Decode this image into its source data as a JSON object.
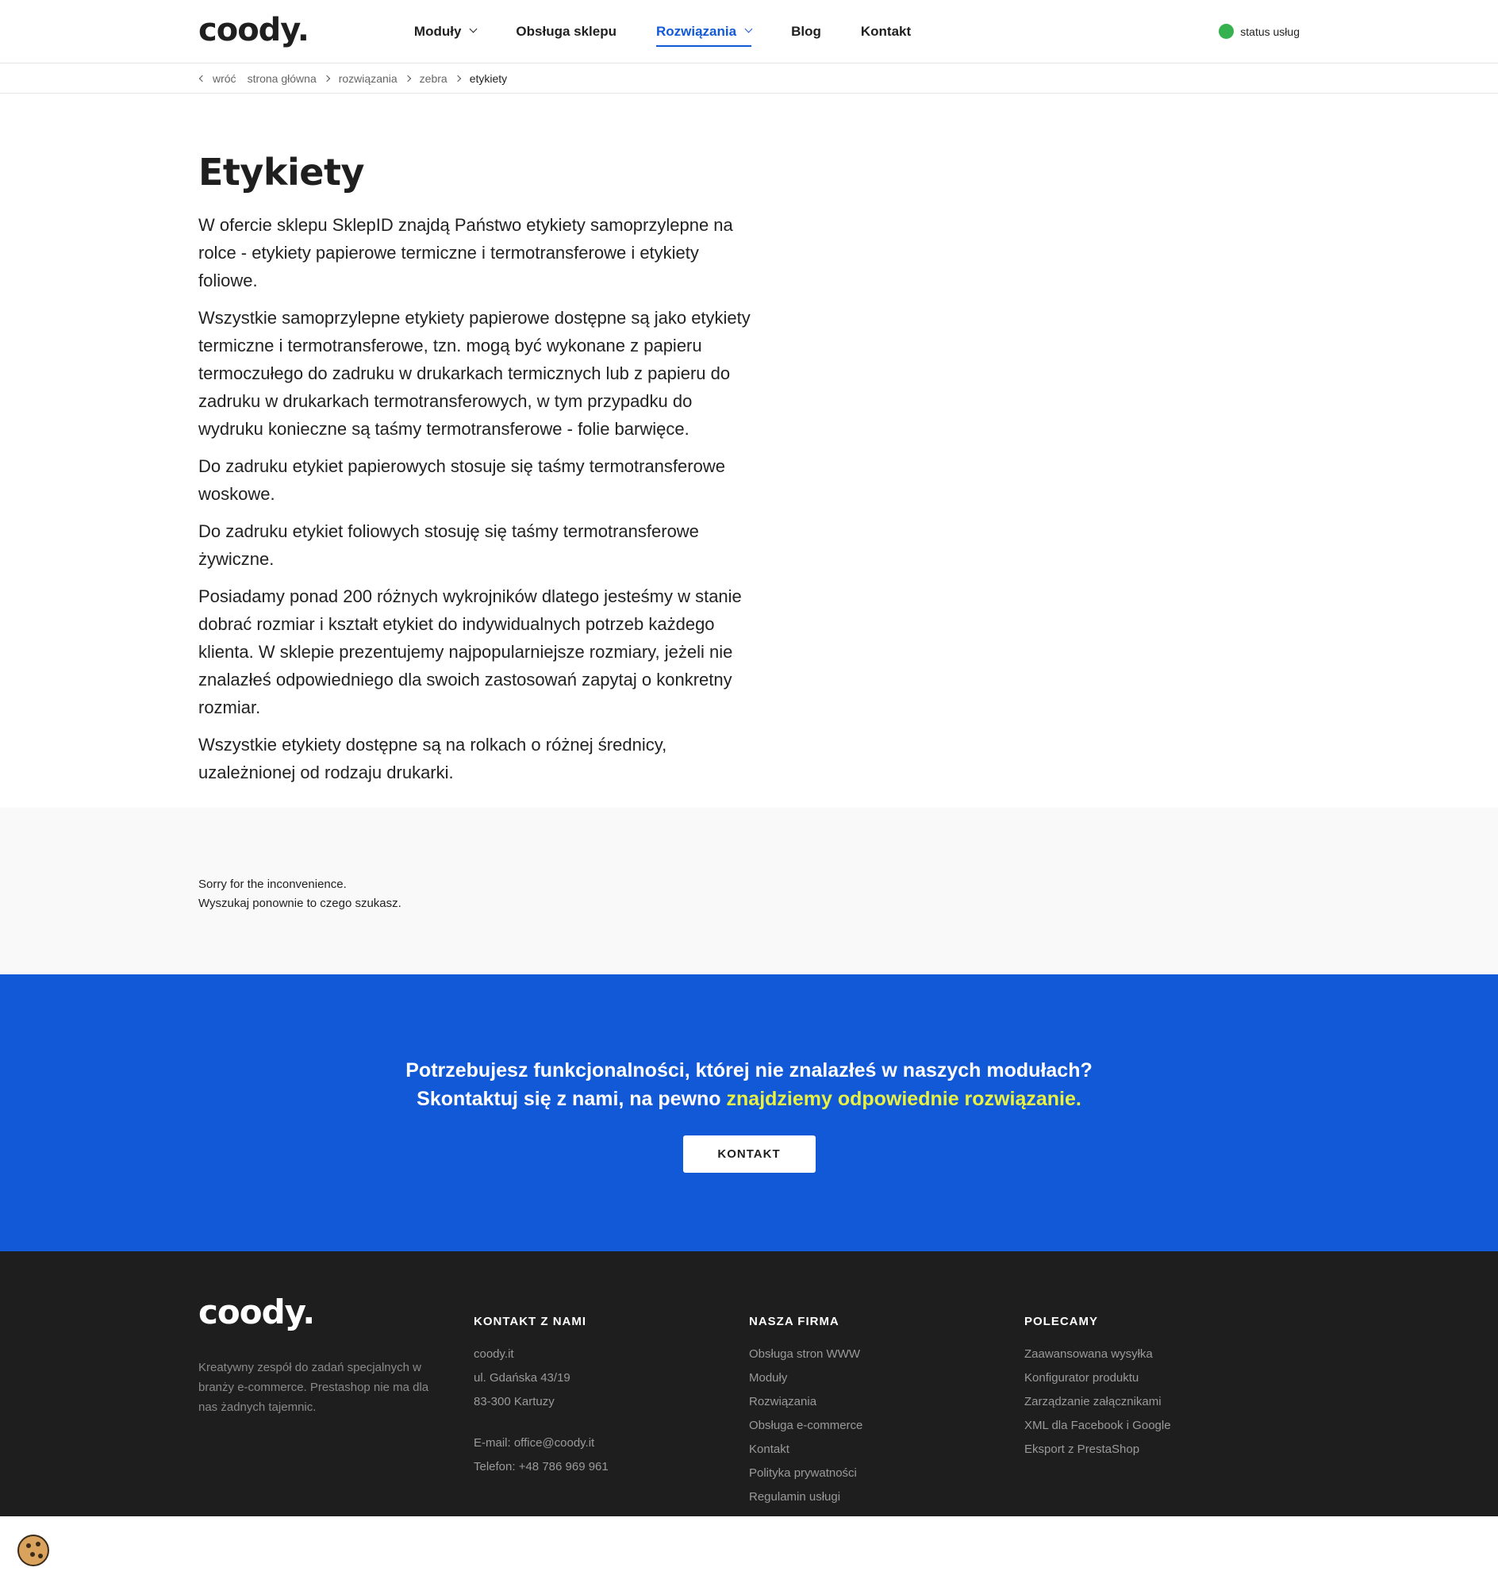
{
  "header": {
    "logo": "coody.",
    "nav": [
      {
        "label": "Moduły",
        "has_dropdown": true,
        "active": false
      },
      {
        "label": "Obsługa sklepu",
        "has_dropdown": false,
        "active": false
      },
      {
        "label": "Rozwiązania",
        "has_dropdown": true,
        "active": true
      },
      {
        "label": "Blog",
        "has_dropdown": false,
        "active": false
      },
      {
        "label": "Kontakt",
        "has_dropdown": false,
        "active": false
      }
    ],
    "status_label": "status usług",
    "status_color": "#35b24f"
  },
  "breadcrumb": {
    "back": "wróć",
    "items": [
      "strona główna",
      "rozwiązania",
      "zebra"
    ],
    "current": "etykiety"
  },
  "main": {
    "title": "Etykiety",
    "paragraphs": [
      "W ofercie sklepu SklepID znajdą Państwo etykiety samoprzylepne na rolce - etykiety papierowe termiczne i termotransferowe i etykiety foliowe.",
      "Wszystkie samoprzylepne etykiety papierowe dostępne są jako etykiety termiczne i termotransferowe, tzn. mogą być wykonane z papieru termoczułego do zadruku w drukarkach termicznych lub z papieru do zadruku w drukarkach termotransferowych, w tym przypadku do wydruku konieczne są taśmy termotransferowe - folie barwięce.",
      "Do zadruku etykiet papierowych stosuje się taśmy termotransferowe woskowe.",
      "Do zadruku etykiet foliowych stosuję się taśmy termotransferowe żywiczne.",
      "Posiadamy ponad 200 różnych wykrojników dlatego jesteśmy w stanie dobrać rozmiar i kształt etykiet do indywidualnych potrzeb każdego klienta. W sklepie prezentujemy najpopularniejsze rozmiary, jeżeli nie znalazłeś odpowiedniego dla swoich zastosowań zapytaj o konkretny rozmiar.",
      "Wszystkie etykiety dostępne są na rolkach o różnej średnicy, uzależnionej od rodzaju drukarki."
    ]
  },
  "sorry": {
    "line1": "Sorry for the inconvenience.",
    "line2": "Wyszukaj ponownie to czego szukasz."
  },
  "cta": {
    "line1": "Potrzebujesz funkcjonalności, której nie znalazłeś w naszych modułach?",
    "line2_start": "Skontaktuj się z nami, na pewno ",
    "line2_highlight": "znajdziemy odpowiednie rozwiązanie.",
    "button": "KONTAKT",
    "bg_color": "#1259d8",
    "highlight_color": "#e8f243"
  },
  "footer": {
    "logo": "coody.",
    "description": "Kreatywny zespół do zadań specjalnych w branży e-commerce. Prestashop nie ma dla nas żadnych tajemnic.",
    "contact": {
      "heading": "KONTAKT Z NAMI",
      "address": [
        "coody.it",
        "ul. Gdańska 43/19",
        "83-300 Kartuzy"
      ],
      "email": "E-mail: office@coody.it",
      "phone": "Telefon: +48 786 969 961"
    },
    "company": {
      "heading": "NASZA FIRMA",
      "links": [
        "Obsługa stron WWW",
        "Moduły",
        "Rozwiązania",
        "Obsługa e-commerce",
        "Kontakt",
        "Polityka prywatności",
        "Regulamin usługi"
      ]
    },
    "recommend": {
      "heading": "POLECAMY",
      "links": [
        "Zaawansowana wysyłka",
        "Konfigurator produktu",
        "Zarządzanie załącznikami",
        "XML dla Facebook i Google",
        "Eksport z PrestaShop"
      ]
    }
  },
  "cookie_icon": "cookie-icon"
}
